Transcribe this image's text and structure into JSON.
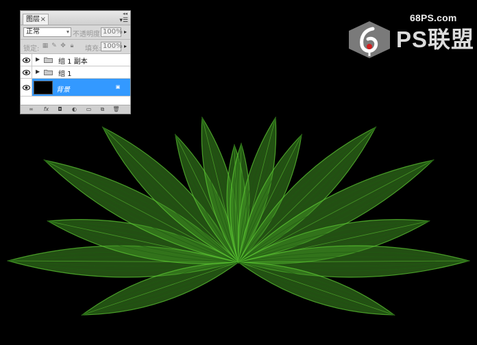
{
  "layers_panel": {
    "tab_title": "图层",
    "close_glyph": "×",
    "collapse_glyph": "◂◂",
    "menu_glyph": "▾☰",
    "blend_mode": "正常",
    "opacity_label": "不透明度:",
    "opacity_value": "100%",
    "lock_label": "锁定:",
    "fill_label": "填充:",
    "fill_value": "100%",
    "layers": [
      {
        "name": "组 1 副本",
        "type": "group",
        "visible": true,
        "selected": false
      },
      {
        "name": "组 1",
        "type": "group",
        "visible": true,
        "selected": false
      },
      {
        "name": "背景",
        "type": "background",
        "visible": true,
        "selected": true
      }
    ],
    "bottom_icons": [
      "link-icon",
      "fx-icon",
      "mask-icon",
      "adjustment-icon",
      "new-group-icon",
      "new-layer-icon",
      "trash-icon"
    ],
    "bottom_glyphs": [
      "∞",
      "fx",
      "◘",
      "◐",
      "▭",
      "⧉",
      "🗑"
    ],
    "fx_label": "fx"
  },
  "watermark": {
    "url": "68PS.com",
    "brand": "PS联盟"
  },
  "artwork": {
    "subject": "lotus-leaves",
    "colors": {
      "background": "#000000",
      "leaf_dark": "#1f5a12",
      "leaf_mid": "#3f8f22",
      "leaf_glow": "#5fcf34"
    }
  }
}
